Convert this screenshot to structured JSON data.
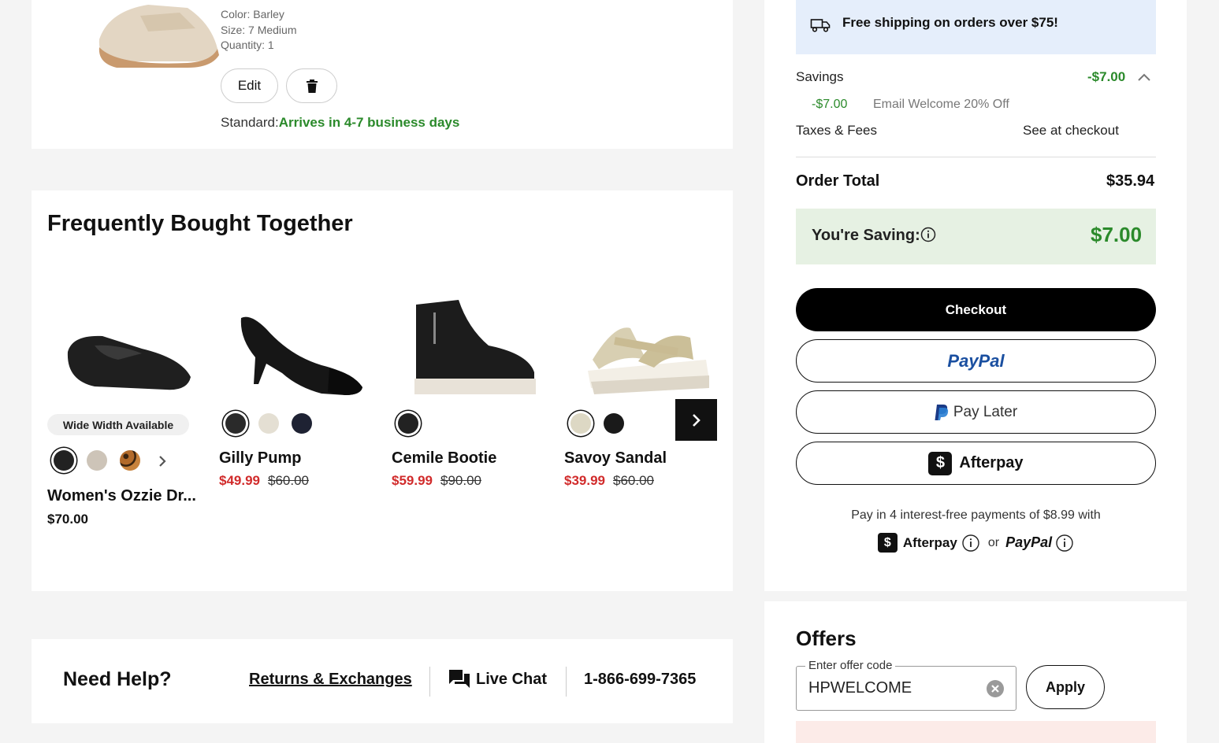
{
  "cart_item": {
    "color": "Color: Barley",
    "size": "Size: 7 Medium",
    "quantity": "Quantity: 1",
    "edit_label": "Edit",
    "shipping_prefix": "Standard:",
    "shipping_eta": "Arrives in 4-7 business days"
  },
  "fbt": {
    "title": "Frequently Bought Together",
    "products": [
      {
        "badge": "Wide Width Available",
        "name": "Women's Ozzie Dr...",
        "price": "$70.00"
      },
      {
        "name": "Gilly Pump",
        "sale": "$49.99",
        "old": "$60.00"
      },
      {
        "name": "Cemile Bootie",
        "sale": "$59.99",
        "old": "$90.00"
      },
      {
        "name": "Savoy Sandal",
        "sale": "$39.99",
        "old": "$60.00"
      }
    ]
  },
  "help": {
    "title": "Need Help?",
    "returns": "Returns & Exchanges",
    "chat": "Live Chat",
    "phone": "1-866-699-7365"
  },
  "summary": {
    "free_shipping": "Free shipping on orders over $75!",
    "savings_label": "Savings",
    "savings_value": "-$7.00",
    "discount_value": "-$7.00",
    "discount_label": "Email Welcome 20% Off",
    "taxes_label": "Taxes & Fees",
    "taxes_value": "See at checkout",
    "total_label": "Order Total",
    "total_value": "$35.94",
    "saving_label": "You're Saving:",
    "saving_value": "$7.00",
    "checkout": "Checkout",
    "paypal": "PayPal",
    "pay_later": "Pay Later",
    "afterpay": "Afterpay",
    "installments": "Pay in 4 interest-free payments of $8.99 with",
    "afterpay_small": "Afterpay",
    "or": "or",
    "paypal_small": "PayPal"
  },
  "offers": {
    "title": "Offers",
    "field_label": "Enter offer code",
    "code": "HPWELCOME",
    "apply": "Apply"
  },
  "colors": {
    "green": "#2b8a2b",
    "sale_red": "#d12b2b",
    "shipping_bg": "#e5eefb",
    "saving_bg": "#e6f1e3"
  }
}
